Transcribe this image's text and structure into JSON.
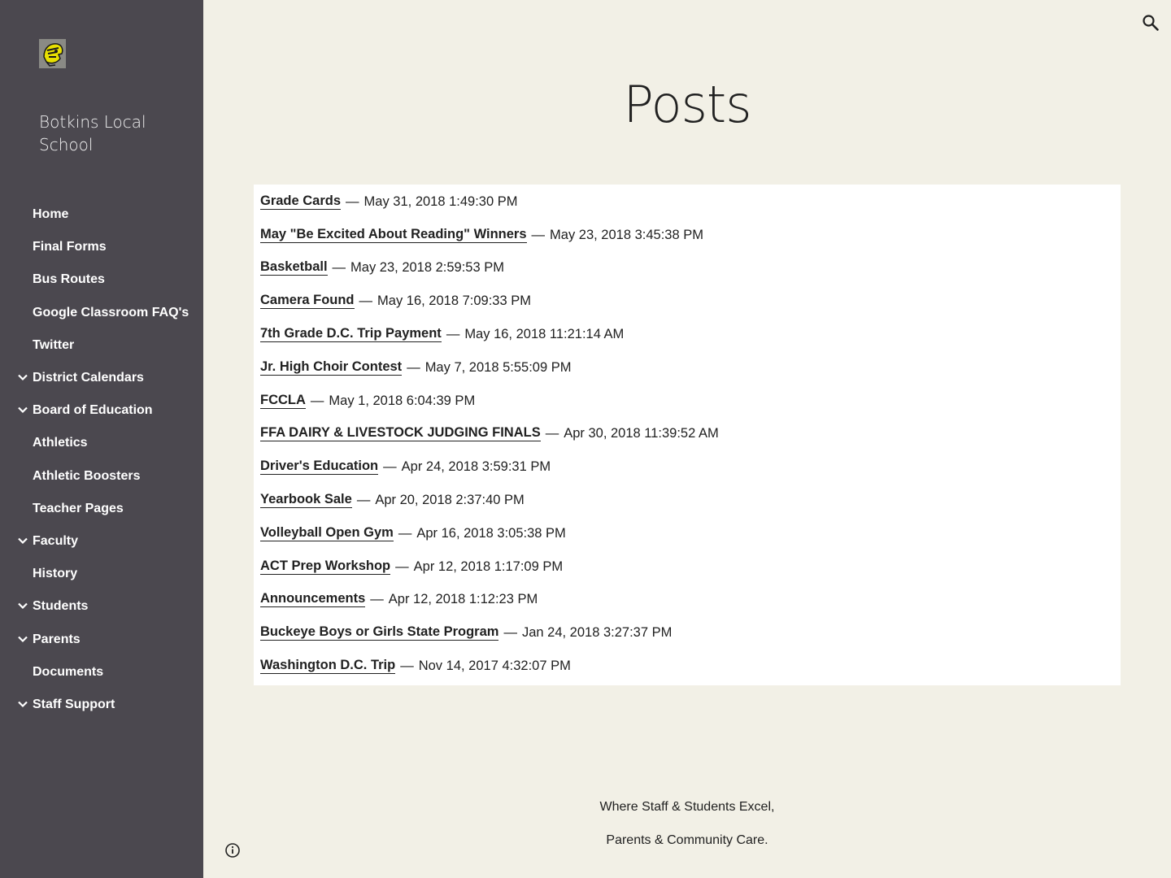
{
  "site": {
    "name": "Botkins Local School",
    "logo_icon": "school-mascot-logo"
  },
  "nav": [
    {
      "label": "Home",
      "has_children": false
    },
    {
      "label": "Final Forms",
      "has_children": false
    },
    {
      "label": "Bus Routes",
      "has_children": false
    },
    {
      "label": "Google Classroom FAQ's",
      "has_children": false
    },
    {
      "label": "Twitter",
      "has_children": false
    },
    {
      "label": "District Calendars",
      "has_children": true
    },
    {
      "label": "Board of Education",
      "has_children": true
    },
    {
      "label": "Athletics",
      "has_children": false
    },
    {
      "label": "Athletic Boosters",
      "has_children": false
    },
    {
      "label": "Teacher Pages",
      "has_children": false
    },
    {
      "label": "Faculty",
      "has_children": true
    },
    {
      "label": "History",
      "has_children": false
    },
    {
      "label": "Students",
      "has_children": true
    },
    {
      "label": "Parents",
      "has_children": true
    },
    {
      "label": "Documents",
      "has_children": false
    },
    {
      "label": "Staff Support",
      "has_children": true
    }
  ],
  "page": {
    "title": "Posts"
  },
  "posts": [
    {
      "title": "Grade Cards",
      "date": "May 31, 2018 1:49:30 PM"
    },
    {
      "title": "May \"Be Excited About Reading\" Winners",
      "date": "May 23, 2018 3:45:38 PM"
    },
    {
      "title": "Basketball",
      "date": "May 23, 2018 2:59:53 PM"
    },
    {
      "title": "Camera Found",
      "date": "May 16, 2018 7:09:33 PM"
    },
    {
      "title": "7th Grade D.C. Trip Payment",
      "date": "May 16, 2018 11:21:14 AM"
    },
    {
      "title": "Jr. High Choir Contest",
      "date": "May 7, 2018 5:55:09 PM"
    },
    {
      "title": "FCCLA",
      "date": "May 1, 2018 6:04:39 PM"
    },
    {
      "title": "FFA DAIRY & LIVESTOCK JUDGING FINALS",
      "date": "Apr 30, 2018 11:39:52 AM"
    },
    {
      "title": "Driver's Education",
      "date": "Apr 24, 2018 3:59:31 PM"
    },
    {
      "title": "Yearbook Sale",
      "date": "Apr 20, 2018 2:37:40 PM"
    },
    {
      "title": "Volleyball Open Gym",
      "date": "Apr 16, 2018 3:05:38 PM"
    },
    {
      "title": "ACT Prep Workshop",
      "date": "Apr 12, 2018 1:17:09 PM"
    },
    {
      "title": "Announcements",
      "date": "Apr 12, 2018 1:12:23 PM"
    },
    {
      "title": "Buckeye Boys or Girls State Program",
      "date": "Jan 24, 2018 3:27:37 PM"
    },
    {
      "title": "Washington D.C. Trip",
      "date": "Nov 14, 2017 4:32:07 PM"
    }
  ],
  "separator": "—",
  "footer": {
    "line1": "Where Staff & Students Excel,",
    "line2": "Parents & Community Care."
  },
  "icons": {
    "search": "search-icon",
    "info": "info-icon",
    "expand": "chevron-down-icon"
  },
  "colors": {
    "sidebar_bg": "#4b484f",
    "page_bg": "#f2f0e6",
    "posts_bg": "#ffffff",
    "text": "#212121"
  }
}
